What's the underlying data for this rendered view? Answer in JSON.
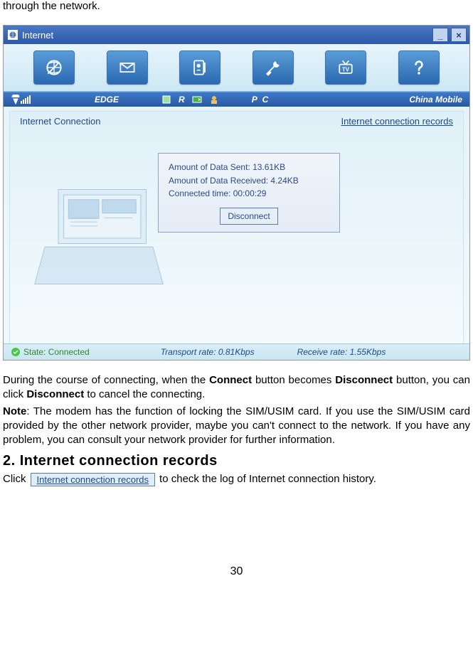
{
  "intro_fragment": "through the network.",
  "window": {
    "title": "Internet",
    "toolbar_icons": [
      "globe-internet",
      "mail",
      "contacts",
      "tools",
      "tv",
      "help"
    ],
    "status_top": {
      "network_type": "EDGE",
      "indicator_r": "R",
      "pc_label": "P C",
      "carrier": "China Mobile"
    },
    "panel": {
      "left_label": "Internet Connection",
      "right_link": "Internet connection records",
      "info": {
        "sent_label": "Amount of Data Sent: 13.61KB",
        "recv_label": "Amount of Data Received: 4.24KB",
        "time_label": "Connected time: 00:00:29",
        "disconnect_btn": "Disconnect"
      }
    },
    "status_bottom": {
      "state_label": "State: Connected",
      "transport_label": "Transport rate: 0.81Kbps",
      "receive_label": "Receive rate: 1.55Kbps"
    }
  },
  "para1": {
    "t1": "During the course of connecting, when the ",
    "b1": "Connect",
    "t2": " button becomes ",
    "b2": "Disconnect",
    "t3": " button, you can click ",
    "b3": "Disconnect",
    "t4": " to cancel the connecting."
  },
  "note": {
    "label": "Note",
    "text": ": The modem has the function of locking the SIM/USIM card. If you use the SIM/USIM card provided by the other network provider, maybe you can't connect to the network. If you have any problem, you can consult your network provider for further information."
  },
  "section2_heading": "2. Internet connection records",
  "click_line": {
    "prefix": "Click ",
    "chip": "Internet connection records",
    "suffix": " to check the log of Internet connection history."
  },
  "page_number": "30"
}
